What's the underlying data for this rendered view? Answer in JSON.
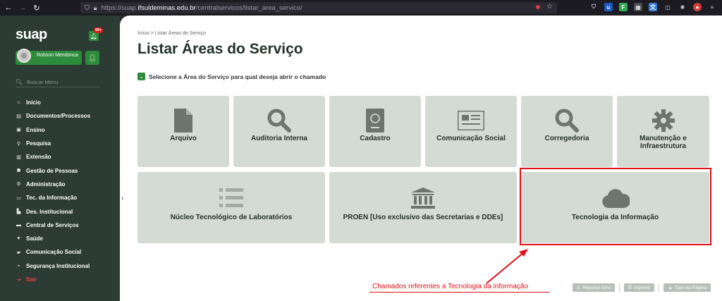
{
  "browser": {
    "url_prefix": "https://suap.",
    "url_domain": "ifsuldeminas.edu.br",
    "url_path": "/centralservicos/listar_area_servico/"
  },
  "sidebar": {
    "logo": "suap",
    "notification_count": "99+",
    "user_name": "Robson Mendonca",
    "search_placeholder": "Buscar Menu",
    "items": [
      {
        "label": "Início",
        "icon": "home-icon"
      },
      {
        "label": "Documentos/Processos",
        "icon": "document-icon"
      },
      {
        "label": "Ensino",
        "icon": "book-icon"
      },
      {
        "label": "Pesquisa",
        "icon": "microscope-icon"
      },
      {
        "label": "Extensão",
        "icon": "extension-icon"
      },
      {
        "label": "Gestão de Pessoas",
        "icon": "people-icon"
      },
      {
        "label": "Administração",
        "icon": "gear-icon"
      },
      {
        "label": "Tec. da Informação",
        "icon": "desktop-icon"
      },
      {
        "label": "Des. Institucional",
        "icon": "chart-icon"
      },
      {
        "label": "Central de Serviços",
        "icon": "ticket-icon"
      },
      {
        "label": "Saúde",
        "icon": "heart-icon"
      },
      {
        "label": "Comunicação Social",
        "icon": "comments-icon"
      },
      {
        "label": "Segurança Institucional",
        "icon": "lock-icon"
      },
      {
        "label": "Sair",
        "icon": "logout-icon"
      }
    ]
  },
  "main": {
    "breadcrumb": "Início > Listar Áreas do Serviço",
    "title": "Listar Áreas do Serviço",
    "subtitle": "Selecione a Área do Serviço para qual deseja abrir o chamado",
    "areas": [
      {
        "label": "Arquivo",
        "icon": "file-icon"
      },
      {
        "label": "Auditoria Interna",
        "icon": "magnifier-icon"
      },
      {
        "label": "Cadastro",
        "icon": "passport-icon"
      },
      {
        "label": "Comunicação Social",
        "icon": "newspaper-icon"
      },
      {
        "label": "Corregedoria",
        "icon": "magnifier-icon"
      },
      {
        "label": "Manutenção e Infraestrutura",
        "icon": "gear-icon"
      },
      {
        "label": "Núcleo Tecnológico de Laboratórios",
        "icon": "list-icon"
      },
      {
        "label": "PROEN [Uso exclusivo das Secretarias e DDEs]",
        "icon": "institution-icon"
      },
      {
        "label": "Tecnologia da Informação",
        "icon": "cloud-icon"
      }
    ],
    "annotation": "Chamados referentes a Tecnologia da informação",
    "footer": {
      "report_error": "Reportar Erro",
      "print": "Imprimir",
      "top": "Topo da Página"
    }
  },
  "colors": {
    "sidebar_bg": "#2c3b34",
    "accent_green": "#2e8b3b",
    "card_bg": "#d4dbd5",
    "annotation_red": "#e0101a"
  }
}
